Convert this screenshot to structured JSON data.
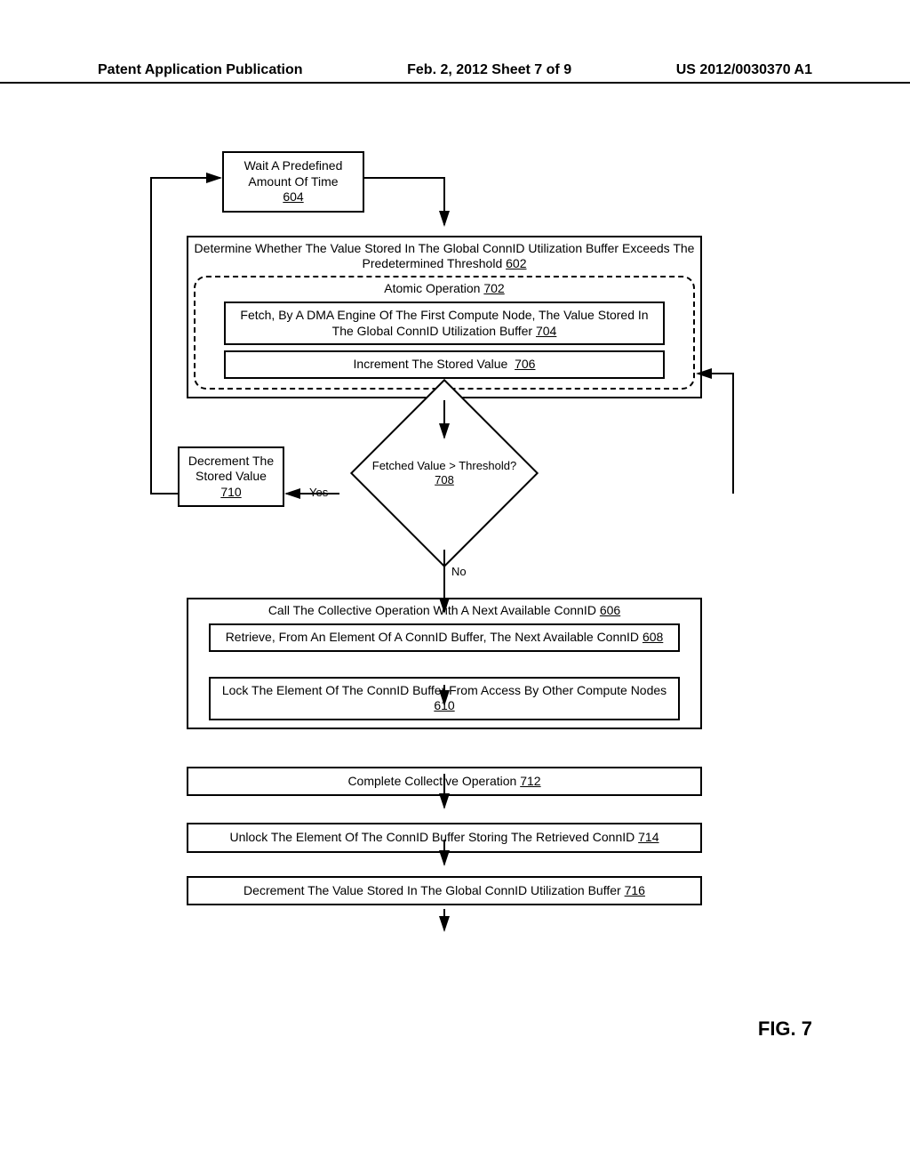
{
  "header": {
    "left": "Patent Application Publication",
    "center": "Feb. 2, 2012  Sheet 7 of 9",
    "right": "US 2012/0030370 A1"
  },
  "figure_label": "FIG. 7",
  "boxes": {
    "b604": {
      "text": "Wait A Predefined Amount Of Time",
      "ref": "604"
    },
    "b602": {
      "text": "Determine Whether The Value Stored In The Global ConnID Utilization Buffer Exceeds The Predetermined Threshold",
      "ref": "602"
    },
    "b702": {
      "text": "Atomic Operation",
      "ref": "702"
    },
    "b704": {
      "text": "Fetch, By A DMA Engine Of The First Compute Node, The Value Stored In The Global ConnID Utilization Buffer",
      "ref": "704"
    },
    "b706": {
      "text": "Increment The Stored Value",
      "ref": "706"
    },
    "b708": {
      "text": "Fetched Value > Threshold?",
      "ref": "708"
    },
    "b710": {
      "text": "Decrement The Stored Value",
      "ref": "710"
    },
    "b606": {
      "text": "Call The Collective Operation With A Next Available ConnID",
      "ref": "606"
    },
    "b608": {
      "text": "Retrieve, From An Element Of A ConnID Buffer, The Next Available ConnID",
      "ref": "608"
    },
    "b610": {
      "text": "Lock The Element Of The ConnID Buffer From Access By Other Compute Nodes",
      "ref": "610"
    },
    "b712": {
      "text": "Complete Collective Operation",
      "ref": "712"
    },
    "b714": {
      "text": "Unlock The Element Of The ConnID Buffer Storing The Retrieved ConnID",
      "ref": "714"
    },
    "b716": {
      "text": "Decrement The Value Stored In The Global ConnID Utilization Buffer",
      "ref": "716"
    }
  },
  "edges": {
    "yes": "Yes",
    "no": "No"
  },
  "chart_data": {
    "type": "flowchart",
    "nodes": [
      {
        "id": "604",
        "label": "Wait A Predefined Amount Of Time",
        "shape": "process"
      },
      {
        "id": "602",
        "label": "Determine Whether The Value Stored In The Global ConnID Utilization Buffer Exceeds The Predetermined Threshold",
        "shape": "process_container"
      },
      {
        "id": "702",
        "label": "Atomic Operation",
        "shape": "dashed_container",
        "parent": "602"
      },
      {
        "id": "704",
        "label": "Fetch, By A DMA Engine Of The First Compute Node, The Value Stored In The Global ConnID Utilization Buffer",
        "shape": "process",
        "parent": "702"
      },
      {
        "id": "706",
        "label": "Increment The Stored Value",
        "shape": "process",
        "parent": "702"
      },
      {
        "id": "708",
        "label": "Fetched Value > Threshold?",
        "shape": "decision"
      },
      {
        "id": "710",
        "label": "Decrement The Stored Value",
        "shape": "process"
      },
      {
        "id": "606",
        "label": "Call The Collective Operation With A Next Available ConnID",
        "shape": "process_container"
      },
      {
        "id": "608",
        "label": "Retrieve, From An Element Of A ConnID Buffer, The Next Available ConnID",
        "shape": "process",
        "parent": "606"
      },
      {
        "id": "610",
        "label": "Lock The Element Of The ConnID Buffer From Access By Other Compute Nodes",
        "shape": "process",
        "parent": "606"
      },
      {
        "id": "712",
        "label": "Complete Collective Operation",
        "shape": "process"
      },
      {
        "id": "714",
        "label": "Unlock The Element Of The ConnID Buffer Storing The Retrieved ConnID",
        "shape": "process"
      },
      {
        "id": "716",
        "label": "Decrement The Value Stored In The Global ConnID Utilization Buffer",
        "shape": "process"
      }
    ],
    "edges": [
      {
        "from": "604",
        "to": "602"
      },
      {
        "from": "704",
        "to": "706"
      },
      {
        "from": "702",
        "to": "708"
      },
      {
        "from": "708",
        "to": "710",
        "label": "Yes"
      },
      {
        "from": "710",
        "to": "604"
      },
      {
        "from": "708",
        "to": "606",
        "label": "No"
      },
      {
        "from": "608",
        "to": "610"
      },
      {
        "from": "606",
        "to": "712"
      },
      {
        "from": "712",
        "to": "714"
      },
      {
        "from": "714",
        "to": "716"
      },
      {
        "from": "602_return",
        "to": "706",
        "note": "return arrow right side into increment"
      }
    ]
  }
}
